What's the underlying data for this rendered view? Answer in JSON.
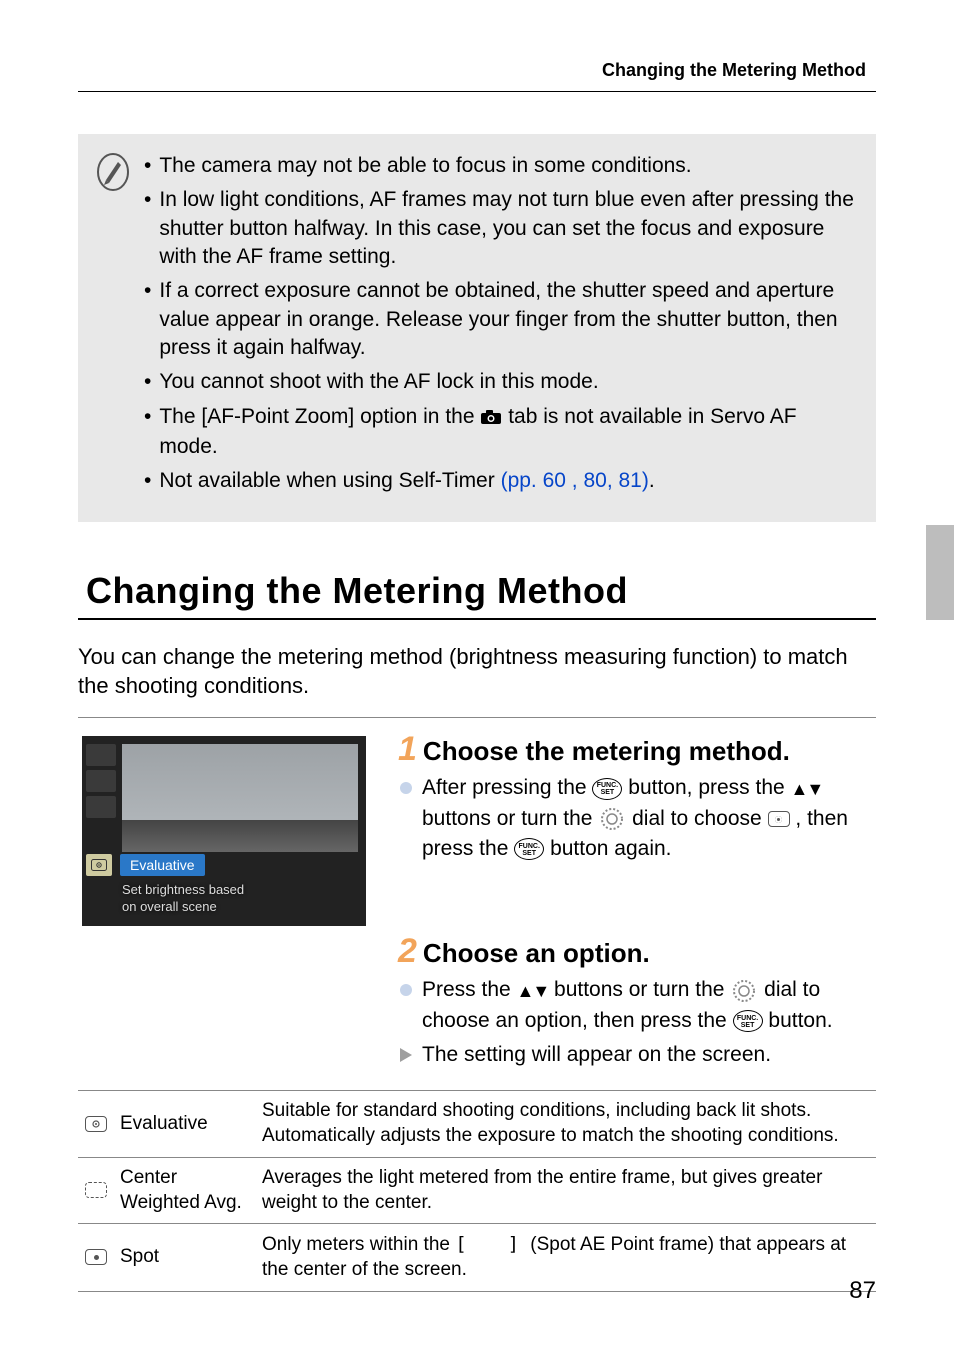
{
  "running_head": "Changing the Metering Method",
  "page_number": "87",
  "notes": {
    "items": [
      "The camera may not be able to focus in some conditions.",
      "In low light conditions, AF frames may not turn blue even after pressing the shutter button halfway. In this case, you can set the focus and exposure with the AF frame setting.",
      "If a correct exposure cannot be obtained, the shutter speed and aperture value appear in orange. Release your finger from the shutter button, then press it again halfway.",
      "You cannot shoot with the AF lock in this mode.",
      "The [AF-Point Zoom] option in the __CAMERA__ tab is not available in Servo AF mode.",
      "Not available when using Self-Timer __LINK__."
    ],
    "self_timer_link": "(pp. 60 , 80, 81)"
  },
  "section_title": "Changing the Metering Method",
  "intro": "You can change the metering method (brightness measuring function) to match the shooting conditions.",
  "screenshot": {
    "selected_label": "Evaluative",
    "subtext_line1": "Set brightness based",
    "subtext_line2": "on overall scene"
  },
  "steps": {
    "s1": {
      "num": "1",
      "title": "Choose the metering method.",
      "line_a_pre": "After pressing the ",
      "line_a_post": " button, press the ",
      "line_b_pre": " buttons or turn the ",
      "line_b_mid": " dial to choose ",
      "line_c_pre": ", then press the ",
      "line_c_post": " button again."
    },
    "s2": {
      "num": "2",
      "title": "Choose an option.",
      "line_a_pre": "Press the ",
      "line_a_mid": " buttons or turn the ",
      "line_a_post": " dial to choose an option, then press the ",
      "line_a_end": " button.",
      "line_b": "The setting will appear on the screen."
    }
  },
  "table": {
    "rows": [
      {
        "name": "Evaluative",
        "desc": "Suitable for standard shooting conditions, including back lit shots. Automatically adjusts the exposure to match the shooting conditions."
      },
      {
        "name": "Center Weighted Avg.",
        "desc": "Averages the light metered from the entire frame, but gives greater weight to the center."
      },
      {
        "name": "Spot",
        "desc_pre": "Only meters within the ",
        "desc_post": " (Spot AE Point frame) that appears at the center of the screen."
      }
    ]
  }
}
